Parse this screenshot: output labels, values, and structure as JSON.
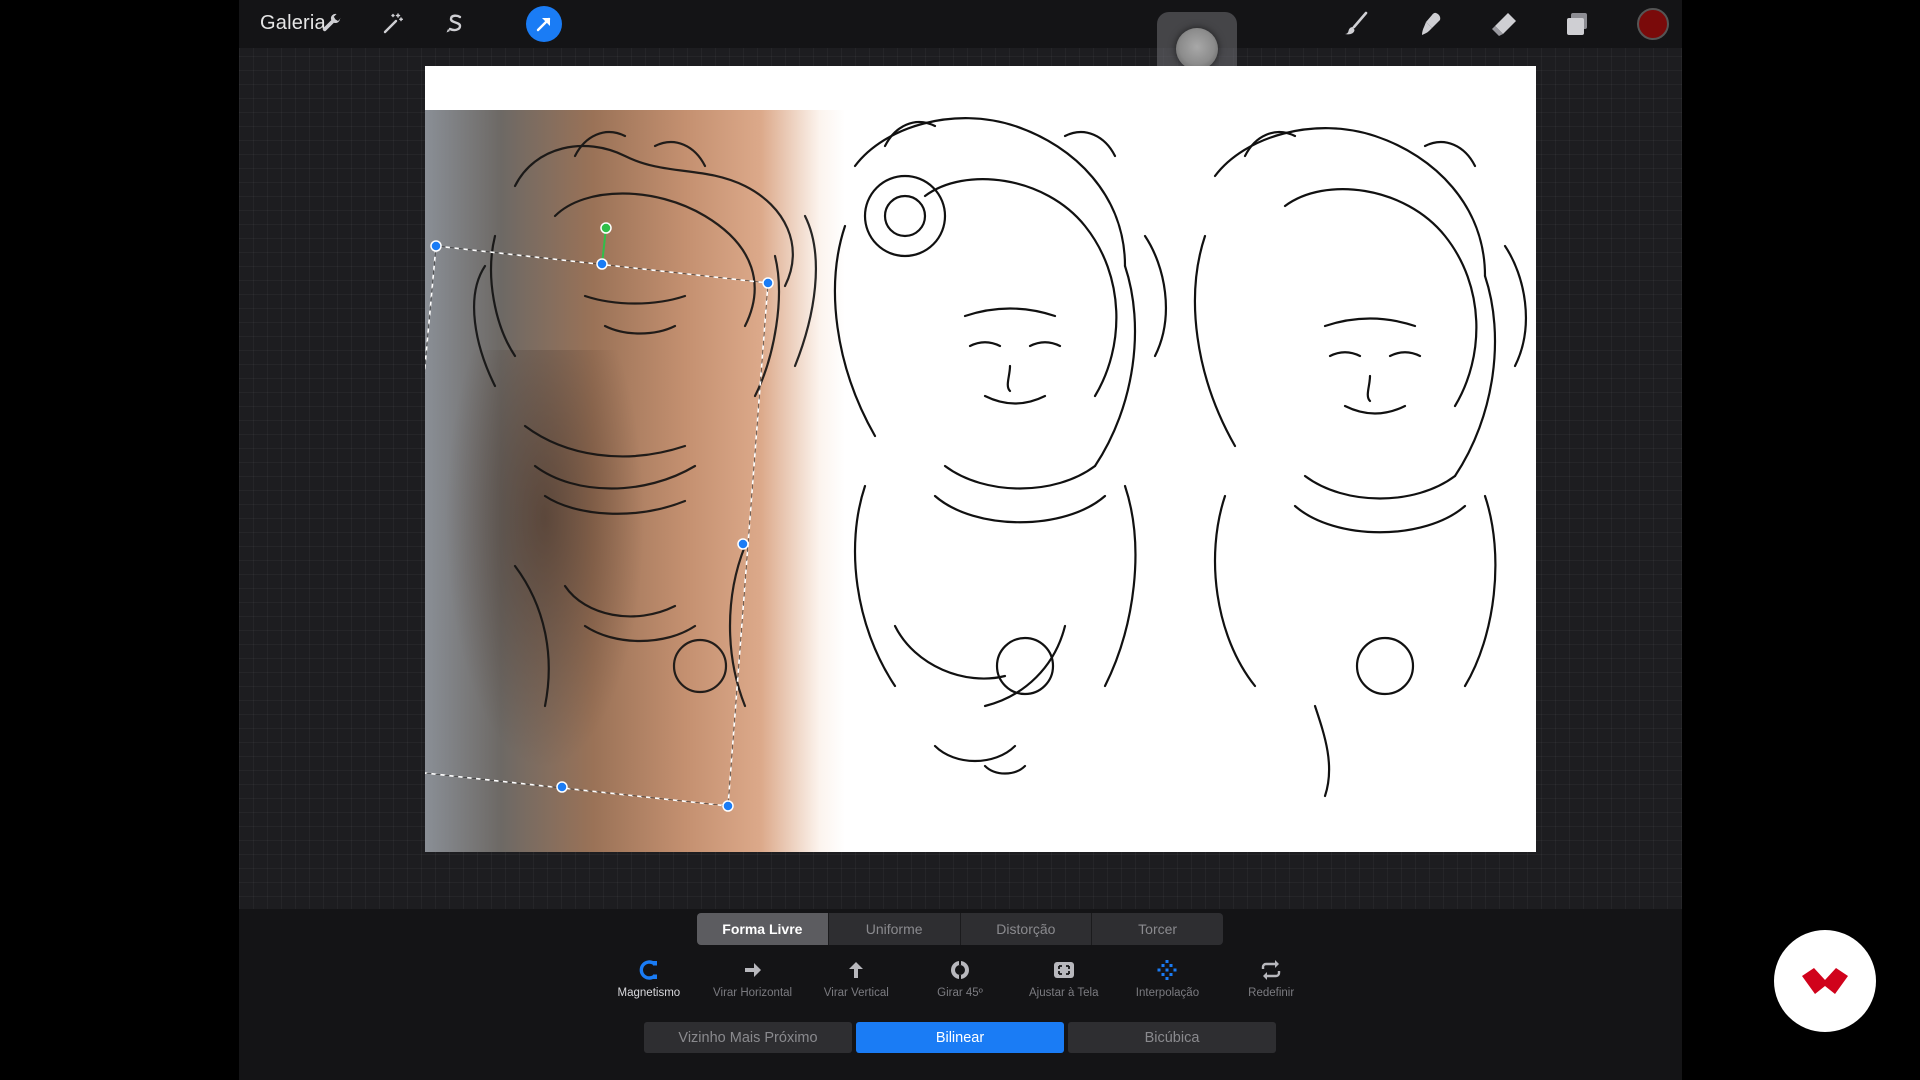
{
  "topbar": {
    "gallery_label": "Galeria"
  },
  "transform": {
    "modes": [
      {
        "label": "Forma Livre",
        "active": true
      },
      {
        "label": "Uniforme",
        "active": false
      },
      {
        "label": "Distorção",
        "active": false
      },
      {
        "label": "Torcer",
        "active": false
      }
    ],
    "tools": [
      {
        "label": "Magnetismo",
        "icon": "magnet-icon",
        "on": true
      },
      {
        "label": "Virar Horizontal",
        "icon": "arrow-right-icon",
        "on": false
      },
      {
        "label": "Virar Vertical",
        "icon": "arrow-up-icon",
        "on": false
      },
      {
        "label": "Girar 45º",
        "icon": "rotate-icon",
        "on": false
      },
      {
        "label": "Ajustar à Tela",
        "icon": "fit-screen-icon",
        "on": false
      },
      {
        "label": "Interpolação",
        "icon": "interpolation-icon",
        "on": false
      },
      {
        "label": "Redefinir",
        "icon": "reset-icon",
        "on": false
      }
    ],
    "interpolation": [
      {
        "label": "Vizinho Mais Próximo",
        "active": false
      },
      {
        "label": "Bilinear",
        "active": true
      },
      {
        "label": "Bicúbica",
        "active": false
      }
    ]
  },
  "colors": {
    "accent": "#1a7cf5",
    "current_color": "#7a0a0a",
    "brand": "#d0021b"
  }
}
